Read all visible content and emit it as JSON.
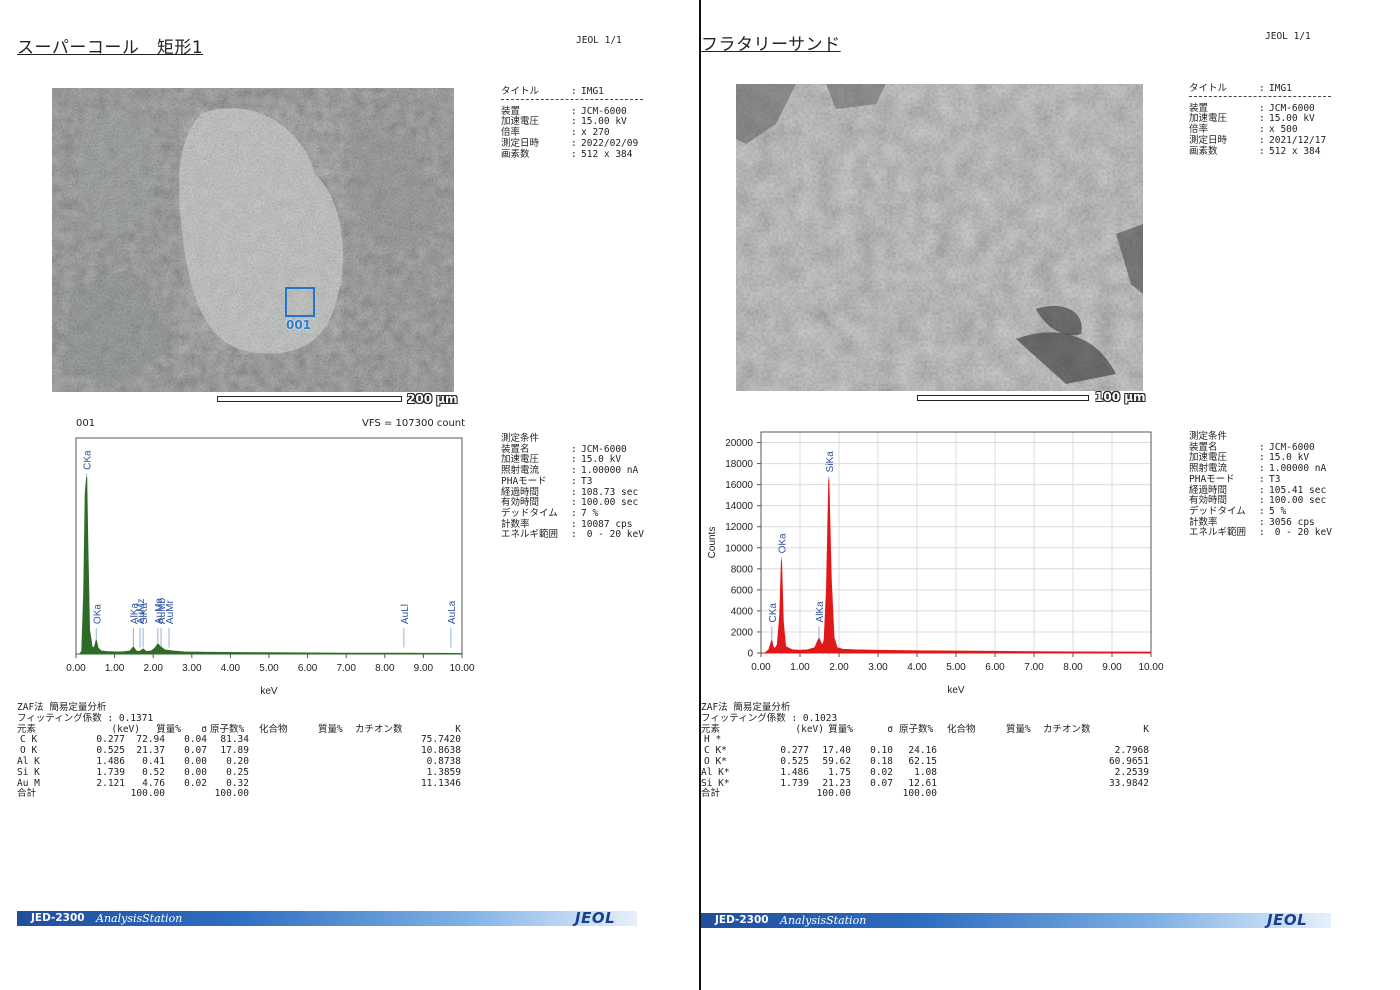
{
  "left": {
    "title": "スーパーコール　矩形1",
    "page_label": "JEOL  1/1",
    "image_info": {
      "title_label": "タイトル",
      "title_value": "IMG1",
      "rows": [
        {
          "key": "装置",
          "value": "JCM-6000"
        },
        {
          "key": "加速電圧",
          "value": "15.00 kV"
        },
        {
          "key": "倍率",
          "value": "x 270"
        },
        {
          "key": "測定日時",
          "value": "2022/02/09"
        },
        {
          "key": "画素数",
          "value": "512 x 384"
        }
      ]
    },
    "scale_label": "200 μm",
    "roi_label": "001",
    "spectrum": {
      "label": "001",
      "vfs": "VFS = 107300 count",
      "xlabel": "keV",
      "xticks": [
        "0.00",
        "1.00",
        "2.00",
        "3.00",
        "4.00",
        "5.00",
        "6.00",
        "7.00",
        "8.00",
        "9.00",
        "10.00"
      ]
    },
    "conditions": {
      "header": "測定条件",
      "rows": [
        {
          "key": "装置名",
          "value": "JCM-6000"
        },
        {
          "key": "加速電圧",
          "value": "15.0 kV"
        },
        {
          "key": "照射電流",
          "value": "1.00000 nA"
        },
        {
          "key": "PHAモード",
          "value": "T3"
        },
        {
          "key": "経過時間",
          "value": "108.73 sec"
        },
        {
          "key": "有効時間",
          "value": "100.00 sec"
        },
        {
          "key": "デッドタイム",
          "value": "7 %"
        },
        {
          "key": "計数率",
          "value": "10087 cps"
        },
        {
          "key": "エネルギ範囲",
          "value": " 0 - 20 keV"
        }
      ]
    },
    "zaf": {
      "method": "ZAF法 簡易定量分析",
      "fitting": "フィッティング係数 : 0.1371",
      "headers": {
        "element": "元素",
        "kev": "(keV)",
        "mass": "質量%",
        "sigma": "σ",
        "atom": "原子数%",
        "compound": "化合物",
        "cmass": "質量%",
        "cation": "カチオン数",
        "k": "K"
      },
      "rows": [
        {
          "element": "C K",
          "kev": "0.277",
          "mass": "72.94",
          "sigma": "0.04",
          "atom": "81.34",
          "k": "75.7420"
        },
        {
          "element": "O K",
          "kev": "0.525",
          "mass": "21.37",
          "sigma": "0.07",
          "atom": "17.89",
          "k": "10.8638"
        },
        {
          "element": "Al K",
          "kev": "1.486",
          "mass": "0.41",
          "sigma": "0.00",
          "atom": "0.20",
          "k": "0.8738"
        },
        {
          "element": "Si K",
          "kev": "1.739",
          "mass": "0.52",
          "sigma": "0.00",
          "atom": "0.25",
          "k": "1.3859"
        },
        {
          "element": "Au M",
          "kev": "2.121",
          "mass": "4.76",
          "sigma": "0.02",
          "atom": "0.32",
          "k": "11.1346"
        }
      ],
      "total": {
        "element": "合計",
        "mass": "100.00",
        "atom": "100.00"
      }
    },
    "footer": {
      "name": "JED-2300",
      "sub": "AnalysisStation",
      "logo": "JEOL"
    }
  },
  "right": {
    "title": "フラタリーサンド",
    "page_label": "JEOL  1/1",
    "image_info": {
      "title_label": "タイトル",
      "title_value": "IMG1",
      "rows": [
        {
          "key": "装置",
          "value": "JCM-6000"
        },
        {
          "key": "加速電圧",
          "value": "15.00 kV"
        },
        {
          "key": "倍率",
          "value": "x 500"
        },
        {
          "key": "測定日時",
          "value": "2021/12/17"
        },
        {
          "key": "画素数",
          "value": "512 x 384"
        }
      ]
    },
    "scale_label": "100 μm",
    "spectrum": {
      "xlabel": "keV",
      "ylabel": "Counts",
      "xticks": [
        "0.00",
        "1.00",
        "2.00",
        "3.00",
        "4.00",
        "5.00",
        "6.00",
        "7.00",
        "8.00",
        "9.00",
        "10.00"
      ],
      "yticks": [
        "0",
        "2000",
        "4000",
        "6000",
        "8000",
        "10000",
        "12000",
        "14000",
        "16000",
        "18000",
        "20000"
      ]
    },
    "conditions": {
      "header": "測定条件",
      "rows": [
        {
          "key": "装置名",
          "value": "JCM-6000"
        },
        {
          "key": "加速電圧",
          "value": "15.0 kV"
        },
        {
          "key": "照射電流",
          "value": "1.00000 nA"
        },
        {
          "key": "PHAモード",
          "value": "T3"
        },
        {
          "key": "経過時間",
          "value": "105.41 sec"
        },
        {
          "key": "有効時間",
          "value": "100.00 sec"
        },
        {
          "key": "デッドタイム",
          "value": "5 %"
        },
        {
          "key": "計数率",
          "value": "3056 cps"
        },
        {
          "key": "エネルギ範囲",
          "value": " 0 - 20 keV"
        }
      ]
    },
    "zaf": {
      "method": "ZAF法 簡易定量分析",
      "fitting": "フィッティング係数 : 0.1023",
      "headers": {
        "element": "元素",
        "kev": "(keV)",
        "mass": "質量%",
        "sigma": "σ",
        "atom": "原子数%",
        "compound": "化合物",
        "cmass": "質量%",
        "cation": "カチオン数",
        "k": "K"
      },
      "rows": [
        {
          "element": "H *",
          "kev": "",
          "mass": "",
          "sigma": "",
          "atom": "",
          "k": ""
        },
        {
          "element": "C K*",
          "kev": "0.277",
          "mass": "17.40",
          "sigma": "0.10",
          "atom": "24.16",
          "k": "2.7968"
        },
        {
          "element": "O K*",
          "kev": "0.525",
          "mass": "59.62",
          "sigma": "0.18",
          "atom": "62.15",
          "k": "60.9651"
        },
        {
          "element": "Al K*",
          "kev": "1.486",
          "mass": "1.75",
          "sigma": "0.02",
          "atom": "1.08",
          "k": "2.2539"
        },
        {
          "element": "Si K*",
          "kev": "1.739",
          "mass": "21.23",
          "sigma": "0.07",
          "atom": "12.61",
          "k": "33.9842"
        }
      ],
      "total": {
        "element": "合計",
        "mass": "100.00",
        "atom": "100.00"
      }
    },
    "footer": {
      "name": "JED-2300",
      "sub": "AnalysisStation",
      "logo": "JEOL"
    }
  },
  "chart_data": [
    {
      "type": "line",
      "title": "001",
      "xlabel": "keV",
      "ylabel": "",
      "xlim": [
        0,
        10
      ],
      "ylim": [
        0,
        107300
      ],
      "series": [
        {
          "name": "",
          "color": "#2e6b26",
          "x": [
            0.0,
            0.1,
            0.15,
            0.2,
            0.24,
            0.277,
            0.31,
            0.35,
            0.42,
            0.48,
            0.525,
            0.57,
            0.65,
            0.8,
            1.0,
            1.2,
            1.4,
            1.486,
            1.56,
            1.65,
            1.739,
            1.82,
            1.95,
            2.05,
            2.121,
            2.2,
            2.3,
            2.5,
            2.8,
            3.5,
            5,
            7,
            8.5,
            9,
            9.5,
            10
          ],
          "y": [
            0,
            0,
            1500,
            30000,
            80000,
            88000,
            50000,
            12000,
            3000,
            3500,
            7000,
            3000,
            1500,
            1200,
            1000,
            1000,
            1500,
            3500,
            1500,
            1200,
            2500,
            1200,
            1500,
            3000,
            5000,
            3500,
            2000,
            1500,
            1000,
            800,
            600,
            400,
            350,
            300,
            300,
            200
          ]
        }
      ],
      "peak_labels": [
        {
          "label": "CKa",
          "x": 0.277
        },
        {
          "label": "OKa",
          "x": 0.525
        },
        {
          "label": "AlKa",
          "x": 1.486
        },
        {
          "label": "SiKa",
          "x": 1.739
        },
        {
          "label": "AuMz",
          "x": 1.66
        },
        {
          "label": "AuMa",
          "x": 2.121
        },
        {
          "label": "AuMb",
          "x": 2.204
        },
        {
          "label": "AuMr",
          "x": 2.41
        },
        {
          "label": "AuLl",
          "x": 8.494
        },
        {
          "label": "AuLa",
          "x": 9.711
        }
      ]
    },
    {
      "type": "line",
      "title": "",
      "xlabel": "keV",
      "ylabel": "Counts",
      "xlim": [
        0,
        10
      ],
      "ylim": [
        0,
        21000
      ],
      "series": [
        {
          "name": "",
          "color": "#e01818",
          "x": [
            0.0,
            0.1,
            0.2,
            0.25,
            0.277,
            0.31,
            0.36,
            0.42,
            0.48,
            0.525,
            0.57,
            0.63,
            0.8,
            1.0,
            1.2,
            1.38,
            1.486,
            1.57,
            1.62,
            1.68,
            1.739,
            1.8,
            1.87,
            1.95,
            2.1,
            2.4,
            3,
            4,
            6,
            8,
            10
          ],
          "y": [
            0,
            0,
            300,
            900,
            1200,
            600,
            400,
            800,
            3500,
            8800,
            3000,
            600,
            300,
            250,
            300,
            500,
            1400,
            700,
            1200,
            6000,
            16500,
            7000,
            1500,
            500,
            350,
            300,
            250,
            200,
            150,
            100,
            80
          ]
        }
      ],
      "peak_labels": [
        {
          "label": "CKa",
          "x": 0.277
        },
        {
          "label": "OKa",
          "x": 0.525
        },
        {
          "label": "AlKa",
          "x": 1.486
        },
        {
          "label": "SiKa",
          "x": 1.739
        }
      ]
    }
  ]
}
